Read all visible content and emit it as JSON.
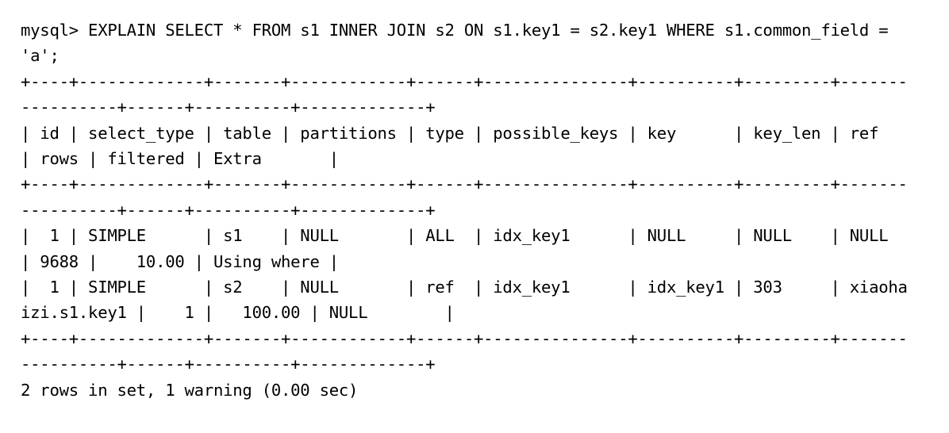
{
  "terminal": {
    "prompt": "mysql>",
    "query": "EXPLAIN SELECT * FROM s1 INNER JOIN s2 ON s1.key1 = s2.key1 WHERE s1.common_field = 'a';",
    "command_line": "mysql> EXPLAIN SELECT * FROM s1 INNER JOIN s2 ON s1.key1 = s2.key1 WHERE s1.common_field = 'a';",
    "separator": "+----+-------------+-------+------------+------+---------------+----------+---------+-----------------+------+----------+-------------+",
    "header_line": "| id | select_type | table | partitions | type | possible_keys | key      | key_len | ref             | rows | filtered | Extra       |",
    "row1_line": "|  1 | SIMPLE      | s1    | NULL       | ALL  | idx_key1      | NULL     | NULL    | NULL            | 9688 |    10.00 | Using where |",
    "row2_line": "|  1 | SIMPLE      | s2    | NULL       | ref  | idx_key1      | idx_key1 | 303     | xiaohaizi.s1.key1 |    1 |   100.00 | NULL        |",
    "status_line": "2 rows in set, 1 warning (0.00 sec)",
    "columns": [
      "id",
      "select_type",
      "table",
      "partitions",
      "type",
      "possible_keys",
      "key",
      "key_len",
      "ref",
      "rows",
      "filtered",
      "Extra"
    ],
    "rows": [
      {
        "id": "1",
        "select_type": "SIMPLE",
        "table": "s1",
        "partitions": "NULL",
        "type": "ALL",
        "possible_keys": "idx_key1",
        "key": "NULL",
        "key_len": "NULL",
        "ref": "NULL",
        "rows": "9688",
        "filtered": "10.00",
        "Extra": "Using where"
      },
      {
        "id": "1",
        "select_type": "SIMPLE",
        "table": "s2",
        "partitions": "NULL",
        "type": "ref",
        "possible_keys": "idx_key1",
        "key": "idx_key1",
        "key_len": "303",
        "ref": "xiaohaizi.s1.key1",
        "rows": "1",
        "filtered": "100.00",
        "Extra": "NULL"
      }
    ],
    "row_count": "2",
    "warning_count": "1",
    "duration": "0.00 sec",
    "colors": {
      "background": "#ffffff",
      "text": "#000000"
    }
  }
}
